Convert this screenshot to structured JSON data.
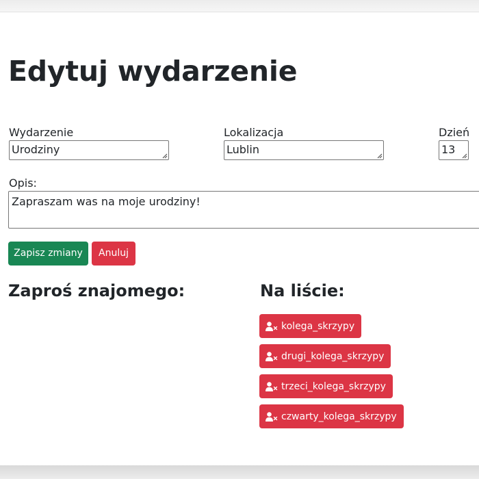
{
  "page": {
    "title": "Edytuj wydarzenie"
  },
  "form": {
    "event_label": "Wydarzenie",
    "event_value": "Urodziny",
    "location_label": "Lokalizacja",
    "location_value": "Lublin",
    "day_label": "Dzień",
    "day_value": "13",
    "description_label": "Opis:",
    "description_value": "Zapraszam was na moje urodziny!"
  },
  "buttons": {
    "save_label": "Zapisz zmiany",
    "cancel_label": "Anuluj"
  },
  "invite": {
    "heading": "Zaproś znajomego:"
  },
  "guests": {
    "heading": "Na liście:",
    "items": [
      {
        "name": "kolega_skrzypy",
        "icon": "user-remove-icon"
      },
      {
        "name": "drugi_kolega_skrzypy",
        "icon": "user-remove-icon"
      },
      {
        "name": "trzeci_kolega_skrzypy",
        "icon": "user-remove-icon"
      },
      {
        "name": "czwarty_kolega_skrzypy",
        "icon": "user-remove-icon"
      }
    ]
  },
  "colors": {
    "success": "#198754",
    "danger": "#dc3545",
    "text": "#212529"
  }
}
